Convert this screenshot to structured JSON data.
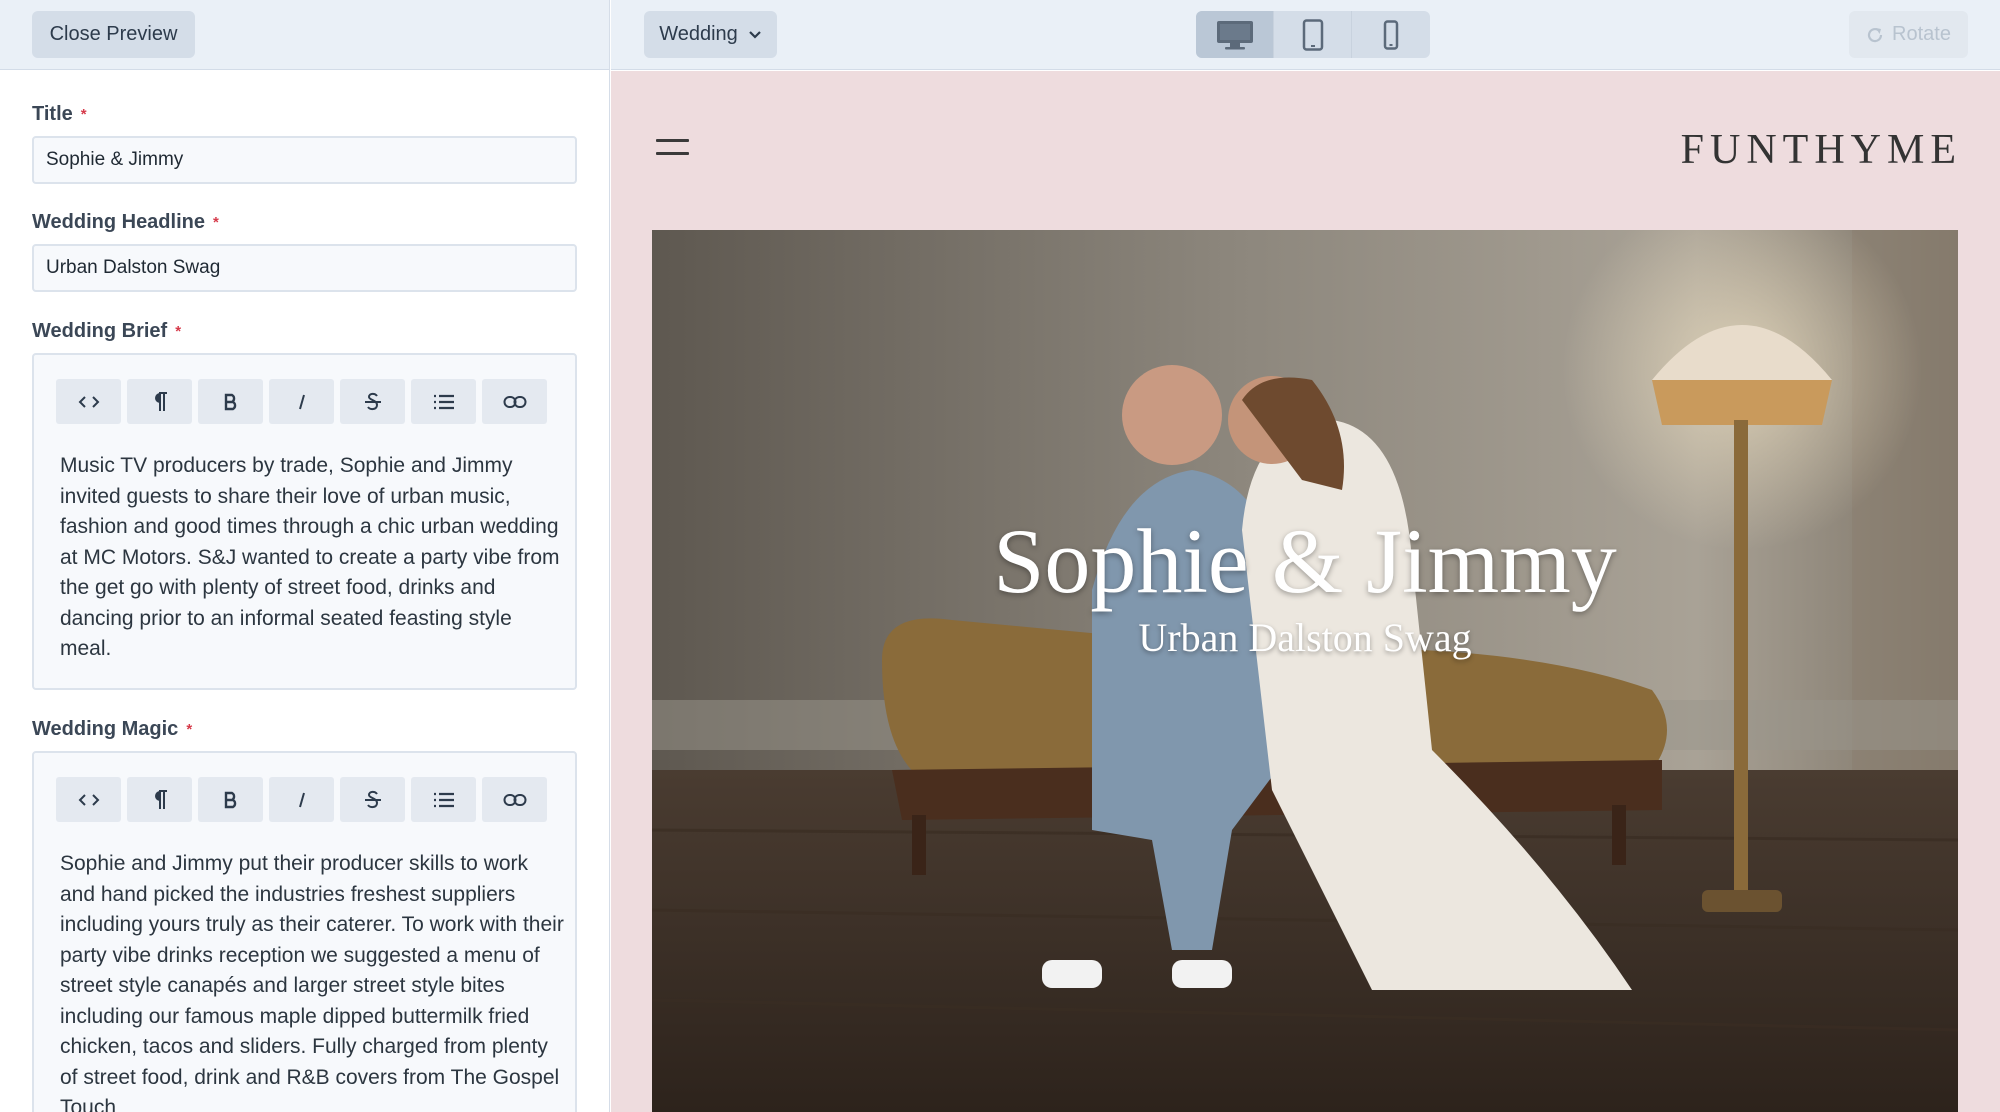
{
  "editor": {
    "close_preview_label": "Close Preview",
    "required_marker": "*",
    "fields": {
      "title": {
        "label": "Title",
        "value": "Sophie & Jimmy"
      },
      "headline": {
        "label": "Wedding Headline",
        "value": "Urban Dalston Swag"
      },
      "brief": {
        "label": "Wedding Brief",
        "text": "Music TV producers by trade, Sophie and Jimmy invited guests to share their love of urban music, fashion and good times through a chic urban wedding at MC Motors. S&J wanted to create a party vibe from the get go with plenty of street food, drinks and dancing prior to an informal seated feasting style meal."
      },
      "magic": {
        "label": "Wedding Magic",
        "text": "Sophie and Jimmy put their producer skills to work and hand picked the industries freshest suppliers including yours truly as their caterer. To work with their party vibe drinks reception we suggested a menu of street style canapés and larger street style bites including our famous maple dipped buttermilk fried chicken, tacos and sliders. Fully charged from plenty of street food, drink and R&B covers from The Gospel Touch"
      }
    },
    "toolbar_icons": [
      "code-icon",
      "paragraph-icon",
      "bold-icon",
      "italic-icon",
      "strikethrough-icon",
      "list-icon",
      "link-icon"
    ]
  },
  "preview_toolbar": {
    "template_select": "Wedding",
    "devices": [
      "desktop",
      "tablet",
      "mobile"
    ],
    "active_device": "desktop",
    "rotate_label": "Rotate"
  },
  "preview": {
    "brand": "FUNTHYME",
    "hero_title": "Sophie & Jimmy",
    "hero_subtitle": "Urban Dalston Swag",
    "background_color": "#eedcde"
  },
  "colors": {
    "toolbar_bg": "#eaf0f7",
    "button_bg": "#d4dde8",
    "required": "#d63a4a"
  }
}
